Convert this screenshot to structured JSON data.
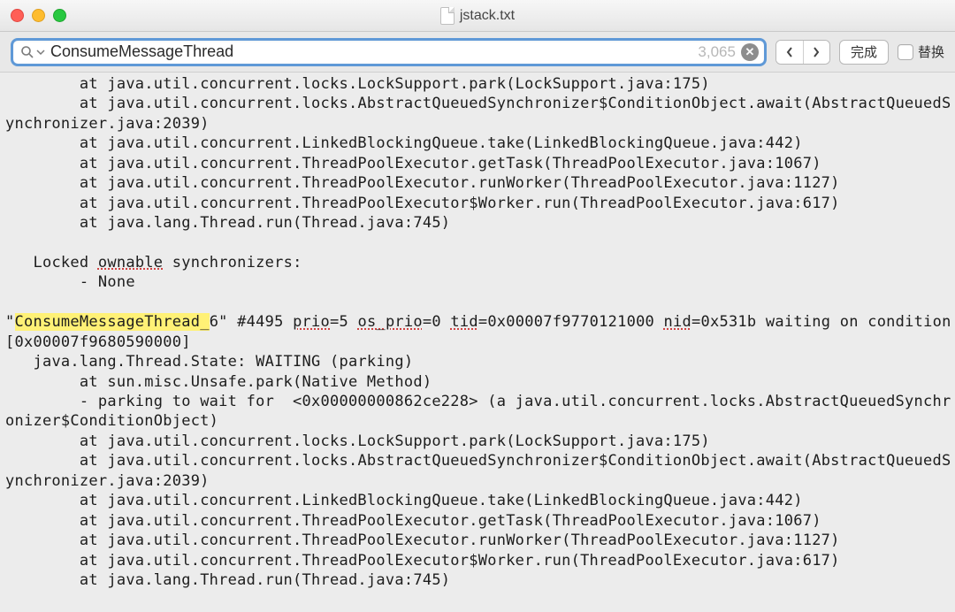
{
  "window": {
    "title": "jstack.txt"
  },
  "search": {
    "query": "ConsumeMessageThread",
    "match_count": "3,065",
    "done_label": "完成",
    "replace_label": "替换"
  },
  "text": {
    "l00a": "        at java.util.concurrent.locks.LockSupport.park(LockSupport.java:175)",
    "l00b": "        at ",
    "l01": "java.util.concurrent.locks.AbstractQueuedSynchronizer$ConditionObject.await(AbstractQueuedSynchronizer.java:2039)",
    "l02": "        at java.util.concurrent.LinkedBlockingQueue.take(LinkedBlockingQueue.java:442)",
    "l03": "        at java.util.concurrent.ThreadPoolExecutor.getTask(ThreadPoolExecutor.java:1067)",
    "l04": "        at java.util.concurrent.ThreadPoolExecutor.runWorker(ThreadPoolExecutor.java:1127)",
    "l05": "        at java.util.concurrent.ThreadPoolExecutor$Worker.run(ThreadPoolExecutor.java:617)",
    "l06": "        at java.lang.Thread.run(Thread.java:745)",
    "l07": "",
    "l08a": "   Locked ",
    "l08b": "ownable",
    "l08c": " synchronizers:",
    "l09": "        - None",
    "l10": "",
    "threadNamePrefix": "\"",
    "threadNameHL": "ConsumeMessageThread_",
    "l11a": "6\" #4495 ",
    "l11b": "prio",
    "l11c": "=5 ",
    "l11d": "os_prio",
    "l11e": "=0 ",
    "l11f": "tid",
    "l11g": "=0x00007f9770121000 ",
    "l11h": "nid",
    "l11i": "=0x531b waiting on condition [0x00007f9680590000]",
    "l12": "   java.lang.Thread.State: WAITING (parking)",
    "l13": "        at sun.misc.Unsafe.park(Native Method)",
    "l14": "        - parking to wait for  <0x00000000862ce228> (a java.util.concurrent.locks.AbstractQueuedSynchronizer$ConditionObject)",
    "l15": "        at java.util.concurrent.locks.LockSupport.park(LockSupport.java:175)",
    "l16a": "        at ",
    "l16b": "java.util.concurrent.locks.AbstractQueuedSynchronizer$ConditionObject.await(AbstractQueuedSynchronizer.java:2039)",
    "l17": "        at java.util.concurrent.LinkedBlockingQueue.take(LinkedBlockingQueue.java:442)",
    "l18": "        at java.util.concurrent.ThreadPoolExecutor.getTask(ThreadPoolExecutor.java:1067)",
    "l19": "        at java.util.concurrent.ThreadPoolExecutor.runWorker(ThreadPoolExecutor.java:1127)",
    "l20": "        at java.util.concurrent.ThreadPoolExecutor$Worker.run(ThreadPoolExecutor.java:617)",
    "l21": "        at java.lang.Thread.run(Thread.java:745)"
  }
}
